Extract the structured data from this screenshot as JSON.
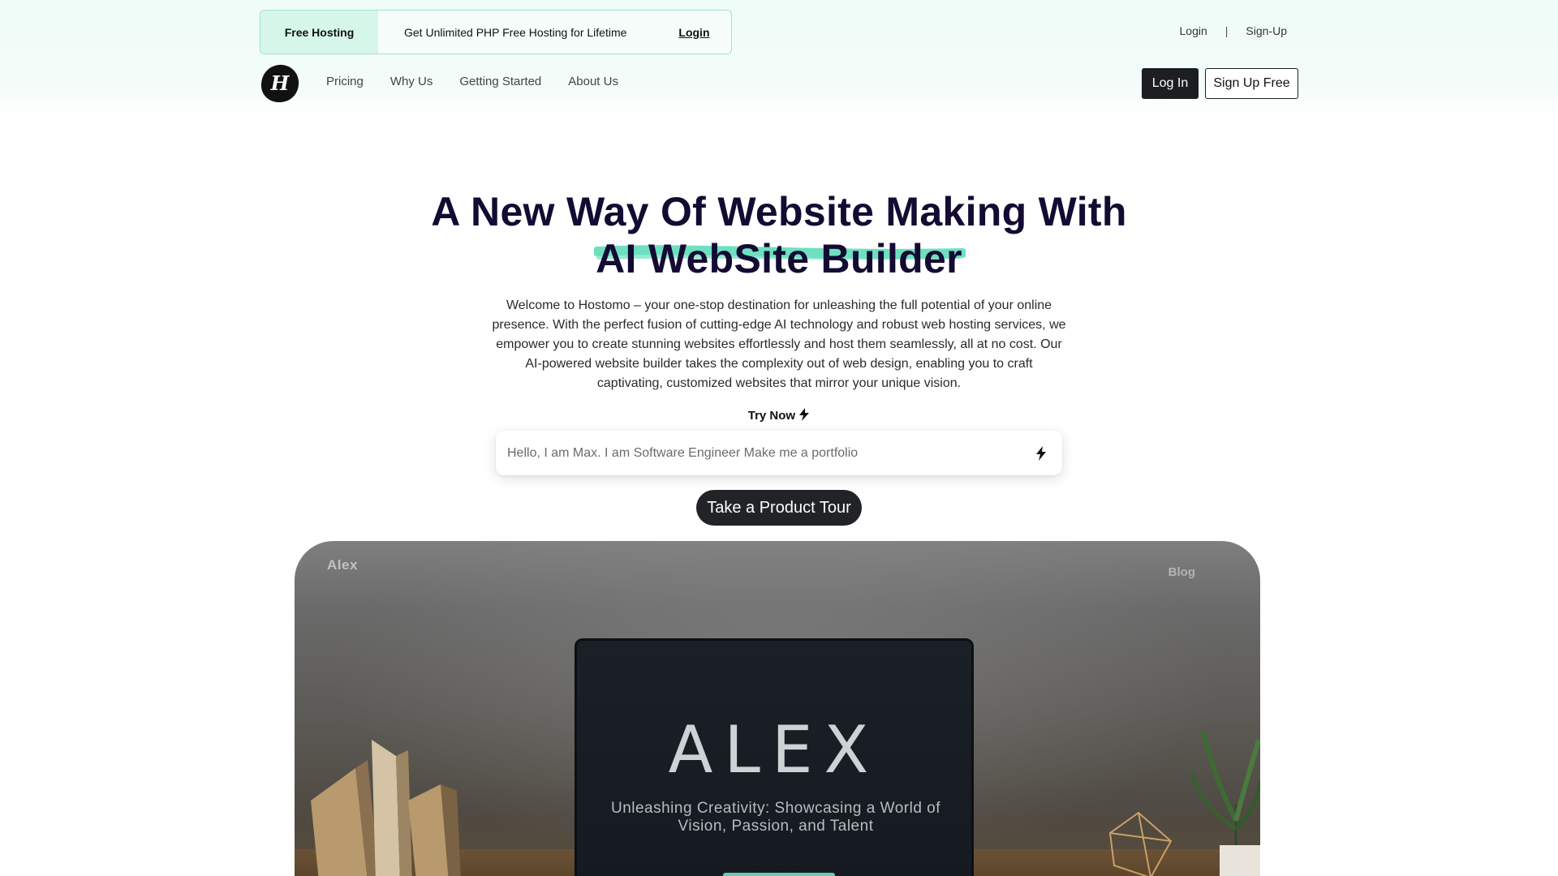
{
  "announcement": {
    "tag": "Free Hosting",
    "message": "Get Unlimited PHP Free Hosting for Lifetime",
    "link": "Login"
  },
  "utility_nav": {
    "login": "Login",
    "separator": "|",
    "signup": "Sign-Up"
  },
  "main_nav": {
    "items": [
      "Pricing",
      "Why Us",
      "Getting Started",
      "About Us"
    ],
    "login_button": "Log In",
    "signup_button": "Sign Up Free"
  },
  "hero": {
    "title_line1": "A New Way Of Website Making With",
    "title_line2": "AI WebSite Builder",
    "description": "Welcome to Hostomo – your one-stop destination for unleashing the full potential of your online presence. With the perfect fusion of cutting-edge AI technology and robust web hosting services, we empower you to create stunning websites effortlessly and host them seamlessly, all at no cost. Our AI-powered website builder takes the complexity out of web design, enabling you to craft captivating, customized websites that mirror your unique vision.",
    "try_now": "Try Now",
    "prompt_placeholder": "Hello, I am Max. I am Software Engineer Make me a portfolio",
    "tour_button": "Take a Product Tour"
  },
  "preview": {
    "brand": "Alex",
    "nav_link": "Blog",
    "screen_title": "ALEX",
    "screen_tagline": "Unleashing Creativity: Showcasing a World of Vision, Passion, and Talent"
  },
  "colors": {
    "accent": "#6ee0c0",
    "title": "#140b33",
    "dark_button": "#1c1e22"
  }
}
